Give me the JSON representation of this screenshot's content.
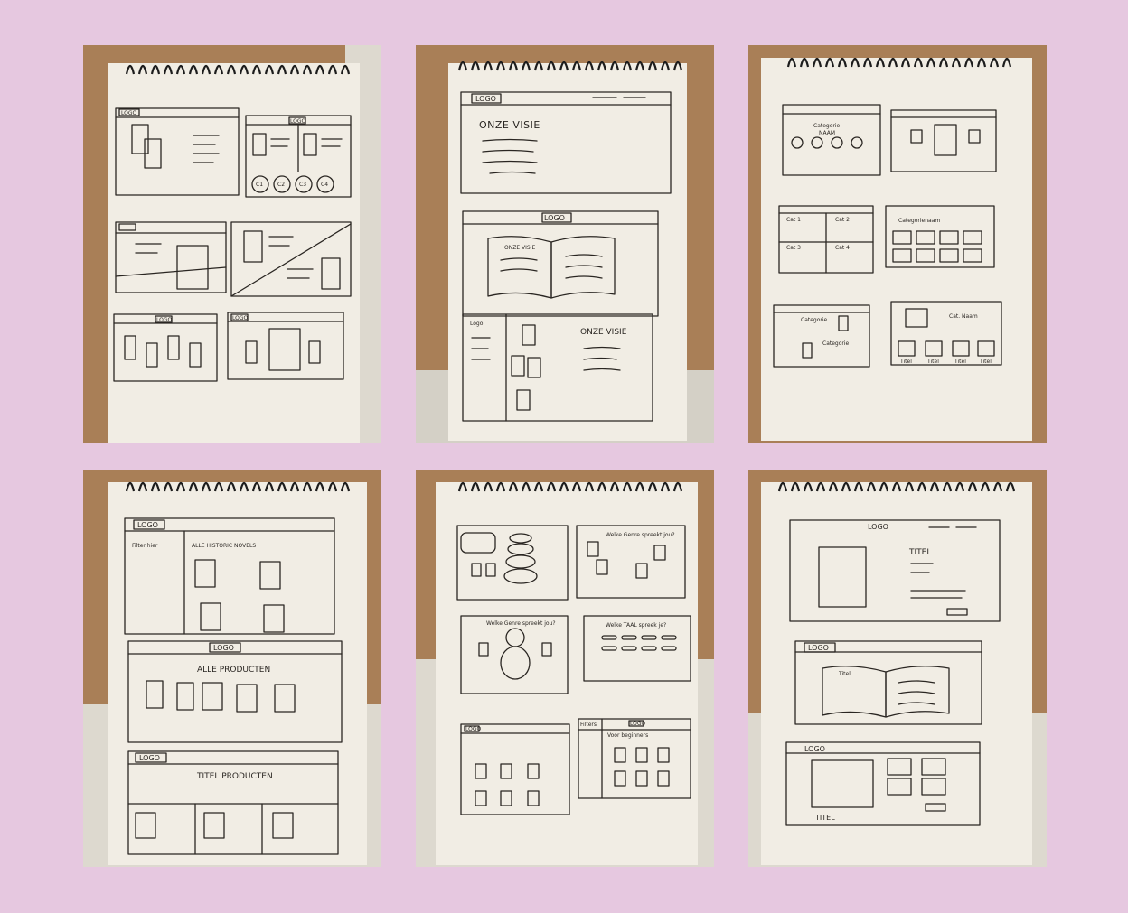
{
  "background_color": "#e6c8e0",
  "paper_color": "#f1ede4",
  "photos": [
    {
      "id": "photo-1",
      "labels": {
        "logo_a": "LOGO",
        "logo_b": "LOGO",
        "logo_c": "LOGO",
        "logo_d": "LOGO",
        "c1": "C1",
        "c2": "C2",
        "c3": "C3",
        "c4": "C4"
      }
    },
    {
      "id": "photo-2",
      "labels": {
        "logo_top": "LOGO",
        "onze_visie_top": "ONZE VISIE",
        "logo_mid": "LOGO",
        "onze_visie_book": "ONZE VISIE",
        "logo_bottom": "Logo",
        "onze_visie_bottom": "ONZE VISIE"
      }
    },
    {
      "id": "photo-3",
      "labels": {
        "categorie_naam": "Categorie",
        "categorie_naam_2": "NAAM",
        "cat1": "Cat 1",
        "cat2": "Cat 2",
        "cat3": "Cat 3",
        "cat4": "Cat 4",
        "categorienaam": "Categorienaam",
        "categorie_small": "Categorie",
        "categorie_small_2": "Categorie",
        "cat_naam": "Cat. Naam",
        "titel1": "Titel",
        "titel2": "Titel",
        "titel3": "Titel",
        "titel4": "Titel"
      }
    },
    {
      "id": "photo-4",
      "labels": {
        "logo_top": "LOGO",
        "filter_hier": "Filter hier",
        "alle_historic_novels": "ALLE HISTORIC NOVELS",
        "logo_mid": "LOGO",
        "alle_producten": "ALLE PRODUCTEN",
        "logo_bottom": "LOGO",
        "titel_producten": "TITEL PRODUCTEN"
      }
    },
    {
      "id": "photo-5",
      "labels": {
        "welke_genre": "Welke Genre spreekt jou?",
        "welke_genre_2": "Welke Genre spreekt jou?",
        "welke_taal": "Welke TAAL spreek je?",
        "logo_a": "LOGO",
        "filters": "Filters",
        "logo_b": "LOGO",
        "voor_beginners": "Voor beginners"
      }
    },
    {
      "id": "photo-6",
      "labels": {
        "logo_top": "LOGO",
        "titel_top": "TITEL",
        "logo_mid": "LOGO",
        "titel_book": "Titel",
        "logo_bottom": "LOGO",
        "titel_bottom": "TITEL"
      }
    }
  ]
}
